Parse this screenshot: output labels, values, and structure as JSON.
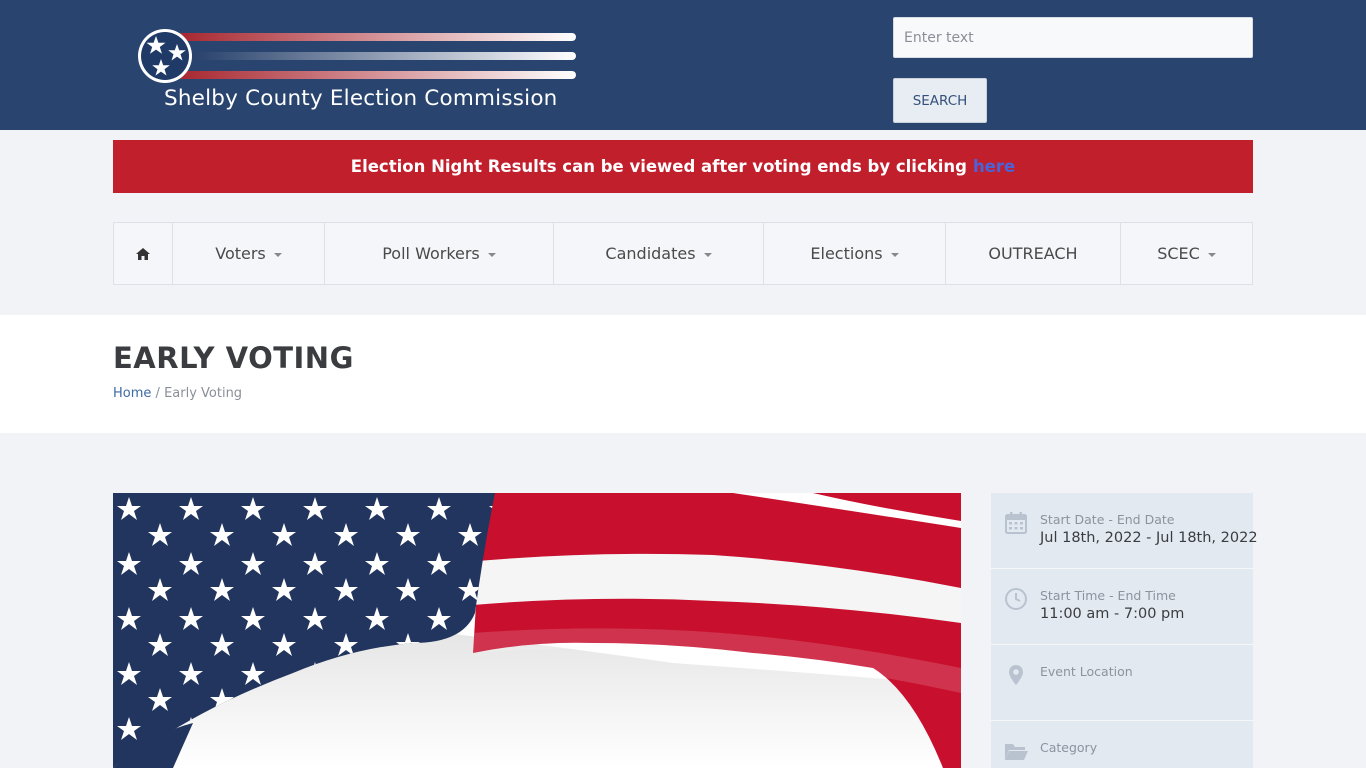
{
  "header": {
    "logo_text": "Shelby County Election Commission",
    "search_placeholder": "Enter text",
    "search_button": "SEARCH"
  },
  "alert": {
    "text": "Election Night Results can be viewed after voting ends by clicking",
    "link_text": "here"
  },
  "nav": {
    "items": [
      {
        "label": "",
        "icon": "home-icon",
        "dropdown": false
      },
      {
        "label": "Voters",
        "dropdown": true
      },
      {
        "label": "Poll Workers",
        "dropdown": true
      },
      {
        "label": "Candidates",
        "dropdown": true
      },
      {
        "label": "Elections",
        "dropdown": true
      },
      {
        "label": "OUTREACH",
        "dropdown": false
      },
      {
        "label": "SCEC",
        "dropdown": true
      }
    ]
  },
  "page": {
    "title": "EARLY VOTING",
    "breadcrumb": {
      "home": "Home",
      "separator": "/",
      "current": "Early Voting"
    }
  },
  "event": {
    "items": [
      {
        "icon": "calendar-icon",
        "label": "Start Date - End Date",
        "value": "Jul 18th, 2022 - Jul 18th, 2022"
      },
      {
        "icon": "clock-icon",
        "label": "Start Time - End Time",
        "value": "11:00 am - 7:00 pm"
      },
      {
        "icon": "map-pin-icon",
        "label": "Event Location",
        "value": ""
      },
      {
        "icon": "folder-icon",
        "label": "Category",
        "value": ""
      }
    ]
  },
  "colors": {
    "header_bg": "#28446f",
    "alert_bg": "#c21f2d",
    "alert_link": "#4b63d6",
    "sidebar_bg": "#e3e9f1"
  }
}
